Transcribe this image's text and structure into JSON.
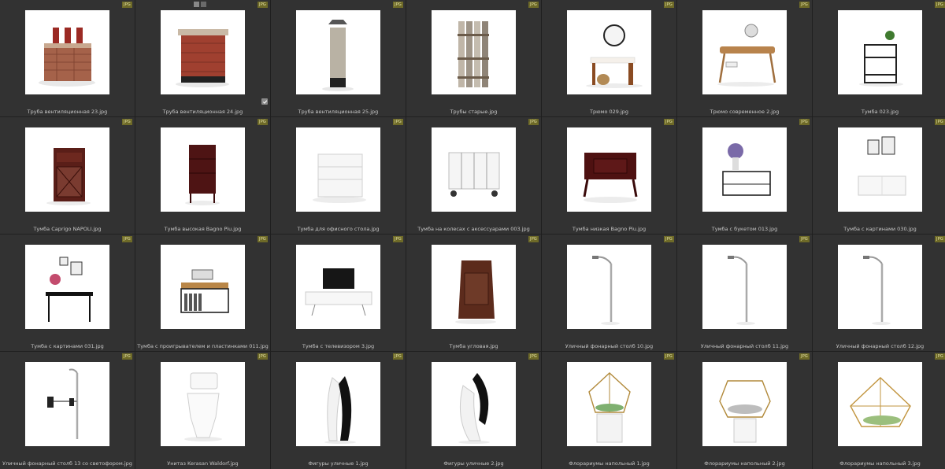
{
  "browser": {
    "badge_label": "JPG",
    "items": [
      {
        "label": "Труба вентиляционная 23.jpg",
        "icon": "brick-chimney-triple-pipe-icon"
      },
      {
        "label": "Труба вентиляционная 24.jpg",
        "icon": "brick-chimney-icon",
        "selected": true
      },
      {
        "label": "Труба вентиляционная 25.jpg",
        "icon": "stone-chimney-icon"
      },
      {
        "label": "Трубы старые.jpg",
        "icon": "old-pipes-icon"
      },
      {
        "label": "Трюмо 029.jpg",
        "icon": "vanity-mirror-icon"
      },
      {
        "label": "Трюмо современное 2.jpg",
        "icon": "modern-dressing-table-icon"
      },
      {
        "label": "Тумба 023.jpg",
        "icon": "metal-shelf-stand-icon"
      },
      {
        "label": "Тумба Caprigo NAPOLI.jpg",
        "icon": "wooden-cabinet-icon"
      },
      {
        "label": "Тумба высокая Bagno Piu.jpg",
        "icon": "tall-drawer-cabinet-icon"
      },
      {
        "label": "Тумба для офисного стола.jpg",
        "icon": "white-office-drawers-icon"
      },
      {
        "label": "Тумба на колесах с аксессуарами 003.jpg",
        "icon": "rolling-crate-icon"
      },
      {
        "label": "Тумба низкая Bagno Piu.jpg",
        "icon": "low-wooden-nightstand-icon"
      },
      {
        "label": "Тумба с букетом 013.jpg",
        "icon": "metal-table-bouquet-icon"
      },
      {
        "label": "Тумба с картинами 030.jpg",
        "icon": "white-sideboard-pictures-icon"
      },
      {
        "label": "Тумба с картинами 031.jpg",
        "icon": "black-console-pictures-icon"
      },
      {
        "label": "Тумба с проигрывателем и пластинками 011.jpg",
        "icon": "record-player-stand-icon"
      },
      {
        "label": "Тумба с телевизором 3.jpg",
        "icon": "tv-stand-icon"
      },
      {
        "label": "Тумба угловая.jpg",
        "icon": "corner-cabinet-icon"
      },
      {
        "label": "Уличный фонарный столб 10.jpg",
        "icon": "street-lamp-icon"
      },
      {
        "label": "Уличный фонарный столб 11.jpg",
        "icon": "street-lamp-icon"
      },
      {
        "label": "Уличный фонарный столб 12.jpg",
        "icon": "street-lamp-icon"
      },
      {
        "label": "Уличный фонарный столб 13 со светофором.jpg",
        "icon": "street-lamp-traffic-light-icon"
      },
      {
        "label": "Унитаз Kerasan Waldorf.jpg",
        "icon": "toilet-icon"
      },
      {
        "label": "Фигуры уличные 1.jpg",
        "icon": "embracing-figures-icon"
      },
      {
        "label": "Фигуры уличные 2.jpg",
        "icon": "dancing-figures-icon"
      },
      {
        "label": "Флорариумы напольный 1.jpg",
        "icon": "geometric-terrarium-icon"
      },
      {
        "label": "Флорариумы напольный 2.jpg",
        "icon": "hexagonal-terrarium-icon"
      },
      {
        "label": "Флорариумы напольный 3.jpg",
        "icon": "gold-terrarium-icon"
      }
    ]
  },
  "colors": {
    "background": "#1f1f1f",
    "cell": "#323232",
    "badge": "#6e6a28",
    "caption_text": "#c7c7c7"
  }
}
